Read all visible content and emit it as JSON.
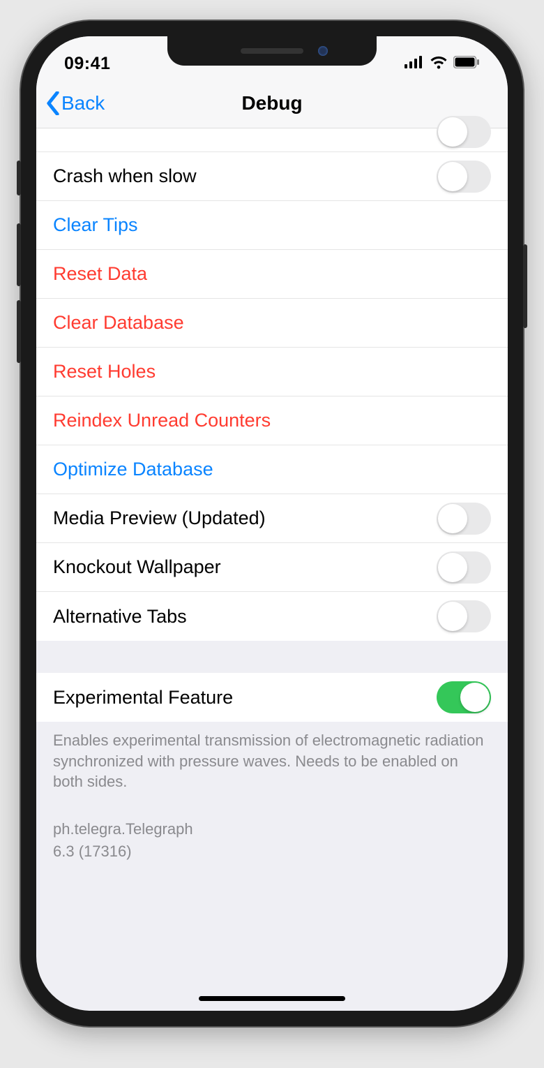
{
  "status": {
    "time": "09:41"
  },
  "nav": {
    "back": "Back",
    "title": "Debug"
  },
  "rows": {
    "crash_when_slow": "Crash when slow",
    "clear_tips": "Clear Tips",
    "reset_data": "Reset Data",
    "clear_database": "Clear Database",
    "reset_holes": "Reset Holes",
    "reindex_unread": "Reindex Unread Counters",
    "optimize_db": "Optimize Database",
    "media_preview": "Media Preview (Updated)",
    "knockout_wallpaper": "Knockout Wallpaper",
    "alternative_tabs": "Alternative Tabs",
    "experimental_feature": "Experimental Feature"
  },
  "switches": {
    "partial_top": false,
    "crash_when_slow": false,
    "media_preview": false,
    "knockout_wallpaper": false,
    "alternative_tabs": false,
    "experimental_feature": true
  },
  "footer": {
    "experimental_desc": "Enables experimental transmission of electromagnetic radiation synchronized with pressure waves. Needs to be enabled on both sides.",
    "bundle": "ph.telegra.Telegraph",
    "version": "6.3 (17316)"
  }
}
